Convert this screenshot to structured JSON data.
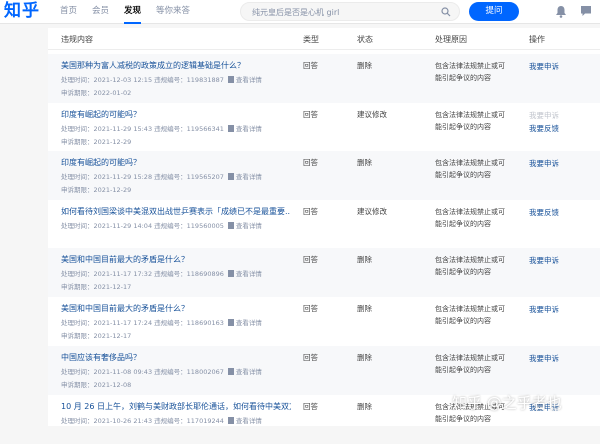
{
  "header": {
    "logo": "知乎",
    "nav": [
      "首页",
      "会员",
      "发现",
      "等你来答"
    ],
    "search_placeholder": "纯元皇后是否是心机 girl",
    "ask_label": "提问"
  },
  "table": {
    "columns": [
      "违规内容",
      "类型",
      "状态",
      "处理原因",
      "操作"
    ],
    "rows": [
      {
        "title": "美国那种为富人减税的政策成立的逻辑基础是什么？",
        "time": "处理时间：2021-12-03 12:15",
        "code": "违规编号：119831887",
        "detail": "查看详情",
        "deadline": "申诉期限：2022-01-02",
        "type": "回答",
        "status": "删除",
        "reason": [
          "包含法律法规禁止或可",
          "能引起争议的内容"
        ],
        "ops": [
          "我要申诉"
        ],
        "ops_disabled": [
          false
        ]
      },
      {
        "title": "印度有崛起的可能吗？",
        "time": "处理时间：2021-11-29 15:43",
        "code": "违规编号：119566341",
        "detail": "查看详情",
        "deadline": "申诉期限：2021-12-29",
        "type": "回答",
        "status": "建议修改",
        "reason": [
          "包含法律法规禁止或可",
          "能引起争议的内容"
        ],
        "ops": [
          "我要申诉",
          "我要反馈"
        ],
        "ops_disabled": [
          true,
          false
        ]
      },
      {
        "title": "印度有崛起的可能吗？",
        "time": "处理时间：2021-11-29 15:28",
        "code": "违规编号：119565207",
        "detail": "查看详情",
        "deadline": "申诉期限：2021-12-29",
        "type": "回答",
        "status": "删除",
        "reason": [
          "包含法律法规禁止或可",
          "能引起争议的内容"
        ],
        "ops": [
          "我要申诉"
        ],
        "ops_disabled": [
          false
        ]
      },
      {
        "title": "如何看待刘国梁谈中美混双出战世乒赛表示「成绩已不是最重要...",
        "time": "处理时间：2021-11-29 14:04",
        "code": "违规编号：119560005",
        "detail": "查看详情",
        "deadline": "",
        "type": "回答",
        "status": "建议修改",
        "reason": [
          "包含法律法规禁止或可",
          "能引起争议的内容"
        ],
        "ops": [
          "我要反馈"
        ],
        "ops_disabled": [
          false
        ]
      },
      {
        "title": "美国和中国目前最大的矛盾是什么？",
        "time": "处理时间：2021-11-17 17:32",
        "code": "违规编号：118690896",
        "detail": "查看详情",
        "deadline": "申诉期限：2021-12-17",
        "type": "回答",
        "status": "删除",
        "reason": [
          "包含法律法规禁止或可",
          "能引起争议的内容"
        ],
        "ops": [
          "我要申诉"
        ],
        "ops_disabled": [
          false
        ]
      },
      {
        "title": "美国和中国目前最大的矛盾是什么？",
        "time": "处理时间：2021-11-17 17:24",
        "code": "违规编号：118690163",
        "detail": "查看详情",
        "deadline": "申诉期限：2021-12-17",
        "type": "回答",
        "status": "删除",
        "reason": [
          "包含法律法规禁止或可",
          "能引起争议的内容"
        ],
        "ops": [
          "我要申诉"
        ],
        "ops_disabled": [
          false
        ]
      },
      {
        "title": "中国应该有奢侈品吗？",
        "time": "处理时间：2021-11-08 09:43",
        "code": "违规编号：118002067",
        "detail": "查看详情",
        "deadline": "申诉期限：2021-12-08",
        "type": "回答",
        "status": "删除",
        "reason": [
          "包含法律法规禁止或可",
          "能引起争议的内容"
        ],
        "ops": [
          "我要申诉"
        ],
        "ops_disabled": [
          false
        ]
      },
      {
        "title": "10 月 26 日上午，刘鹤与美财政部长耶伦通话，如何看待中美双方...",
        "time": "处理时间：2021-10-26 21:43",
        "code": "违规编号：117019244",
        "detail": "查看详情",
        "deadline": "",
        "type": "回答",
        "status": "删除",
        "reason": [
          "包含法律法规禁止或可",
          "能引起争议的内容"
        ],
        "ops": [
          "我要申诉"
        ],
        "ops_disabled": [
          false
        ]
      }
    ]
  },
  "watermark": "知乎 @之乎者也"
}
